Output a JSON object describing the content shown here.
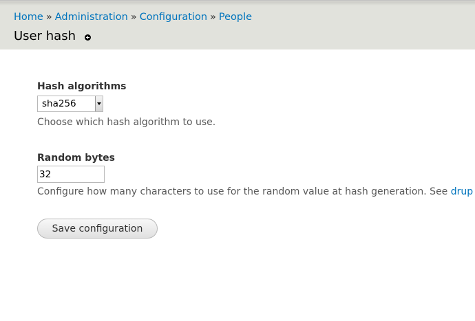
{
  "breadcrumb": {
    "items": [
      "Home",
      "Administration",
      "Configuration",
      "People"
    ],
    "separator": "»"
  },
  "page": {
    "title": "User hash",
    "shortcut_icon": "add-shortcut-icon"
  },
  "form": {
    "hash_algorithms": {
      "label": "Hash algorithms",
      "selected": "sha256",
      "description": "Choose which hash algorithm to use."
    },
    "random_bytes": {
      "label": "Random bytes",
      "value": "32",
      "description": "Configure how many characters to use for the random value at hash generation. See ",
      "link_text": "drup"
    },
    "save_label": "Save configuration"
  },
  "colors": {
    "link": "#0074bd",
    "header_bg": "#e1e2dc",
    "text": "#333333",
    "description": "#595959"
  }
}
